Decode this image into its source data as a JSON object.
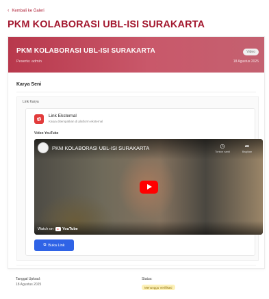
{
  "nav": {
    "back_label": "Kembali ke Galeri"
  },
  "page": {
    "title": "PKM KOLABORASI UBL-ISI SURAKARTA"
  },
  "hero": {
    "title": "PKM KOLABORASI UBL-ISI SURAKARTA",
    "subtitle": "Peserta: admin",
    "badge": "Video",
    "date": "18 Agustus 2025",
    "colors": {
      "start": "#b8384c",
      "end": "#c46170"
    }
  },
  "section": {
    "title": "Karya Seni",
    "link_label": "Link Karya"
  },
  "external_link": {
    "title": "Link Eksternal",
    "description": "Karya ditempatkan di platform eksternal",
    "icon": "external-link-icon"
  },
  "youtube": {
    "label": "Video YouTube",
    "video_title": "PKM KOLABORASI UBL-ISI SURAKARTA",
    "watch_later": "Tonton nanti",
    "share": "Bagikan",
    "watch_on": "Watch on",
    "brand": "YouTube"
  },
  "open_button": {
    "label": "Buka Link",
    "color": "#2f63e6"
  },
  "meta": {
    "upload_label": "Tanggal Upload:",
    "upload_date": "18 Agustus 2025",
    "status_label": "Status:",
    "status_value": "Menunggu Verifikasi"
  }
}
